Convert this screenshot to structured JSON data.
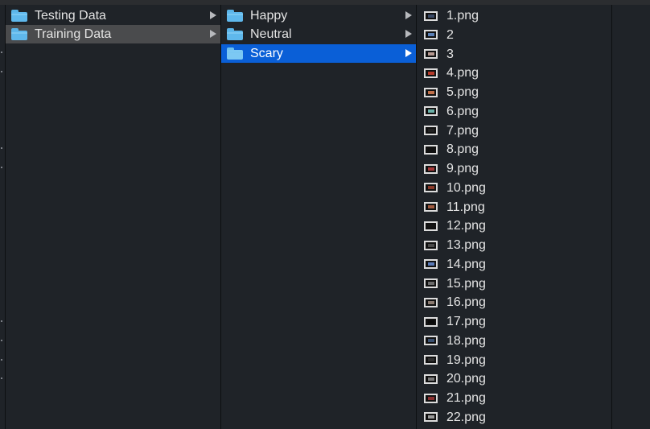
{
  "colors": {
    "background": "#1f2328",
    "selection": "#0a5fd7",
    "hover": "#4a4b4d",
    "folder": "#5fb8ec",
    "text": "#e4e4e4"
  },
  "column1": {
    "items": [
      {
        "label": "Testing Data",
        "icon": "folder-icon"
      },
      {
        "label": "Training Data",
        "icon": "folder-icon"
      }
    ]
  },
  "column2": {
    "items": [
      {
        "label": "Happy",
        "icon": "folder-icon"
      },
      {
        "label": "Neutral",
        "icon": "folder-icon"
      },
      {
        "label": "Scary",
        "icon": "folder-icon"
      }
    ]
  },
  "column3": {
    "files": [
      {
        "label": "1.png",
        "accent": "#3a4a66"
      },
      {
        "label": "2",
        "accent": "#5a7fb5"
      },
      {
        "label": "3",
        "accent": "#b59890"
      },
      {
        "label": "4.png",
        "accent": "#b53a2a"
      },
      {
        "label": "5.png",
        "accent": "#c0704a"
      },
      {
        "label": "6.png",
        "accent": "#6ab0a8"
      },
      {
        "label": "7.png",
        "accent": "#222222"
      },
      {
        "label": "8.png",
        "accent": "#111111"
      },
      {
        "label": "9.png",
        "accent": "#a83a3a"
      },
      {
        "label": "10.png",
        "accent": "#8a3a2a"
      },
      {
        "label": "11.png",
        "accent": "#a05a40"
      },
      {
        "label": "12.png",
        "accent": "#151515"
      },
      {
        "label": "13.png",
        "accent": "#4a4a4a"
      },
      {
        "label": "14.png",
        "accent": "#5a7ab8"
      },
      {
        "label": "15.png",
        "accent": "#6a6a6a"
      },
      {
        "label": "16.png",
        "accent": "#8a7a70"
      },
      {
        "label": "17.png",
        "accent": "#0a0a0a"
      },
      {
        "label": "18.png",
        "accent": "#3a5070"
      },
      {
        "label": "19.png",
        "accent": "#303030"
      },
      {
        "label": "20.png",
        "accent": "#7a7a7a"
      },
      {
        "label": "21.png",
        "accent": "#8a3030"
      },
      {
        "label": "22.png",
        "accent": "#9a9a9a"
      }
    ]
  }
}
